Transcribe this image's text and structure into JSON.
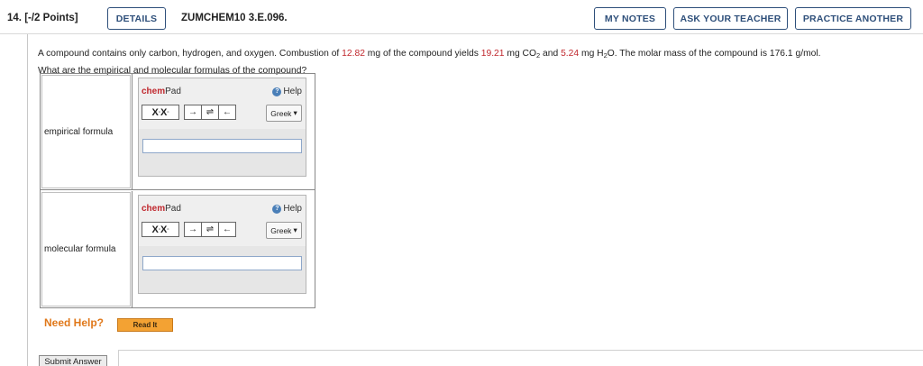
{
  "header": {
    "question_number": "14.",
    "points": "[-/2 Points]",
    "details_label": "DETAILS",
    "question_id": "ZUMCHEM10 3.E.096.",
    "my_notes_label": "MY NOTES",
    "ask_teacher_label": "ASK YOUR TEACHER",
    "practice_label": "PRACTICE ANOTHER"
  },
  "prompt": {
    "part1": "A compound contains only carbon, hydrogen, and oxygen. Combustion of ",
    "mass_compound": "12.82",
    "part2": " mg of the compound yields ",
    "mass_co2": "19.21",
    "part3": " mg CO",
    "co2_sub": "2",
    "part4": " and ",
    "mass_h2o": "5.24",
    "part5": " mg H",
    "h2o_sub": "2",
    "part6": "O. The molar mass of the compound is 176.1 g/mol.",
    "line2": "What are the empirical and molecular formulas of the compound?"
  },
  "answers": [
    {
      "label": "empirical formula",
      "value": ""
    },
    {
      "label": "molecular formula",
      "value": ""
    }
  ],
  "chempad": {
    "title_chem": "chem",
    "title_pad": "Pad",
    "help_label": "Help",
    "help_icon_glyph": "?",
    "greek_label": "Greek",
    "dropdown_glyph": "▾",
    "arrow_right": "→",
    "equilibrium": "⇌",
    "arrow_left": "←"
  },
  "help": {
    "need_help_label": "Need Help?",
    "read_it_label": "Read It"
  },
  "footer": {
    "submit_label": "Submit Answer"
  },
  "colors": {
    "accent": "#2e4f7a",
    "value_red": "#c0272d",
    "need_help_orange": "#e0781a",
    "read_it_bg": "#f3a233"
  }
}
